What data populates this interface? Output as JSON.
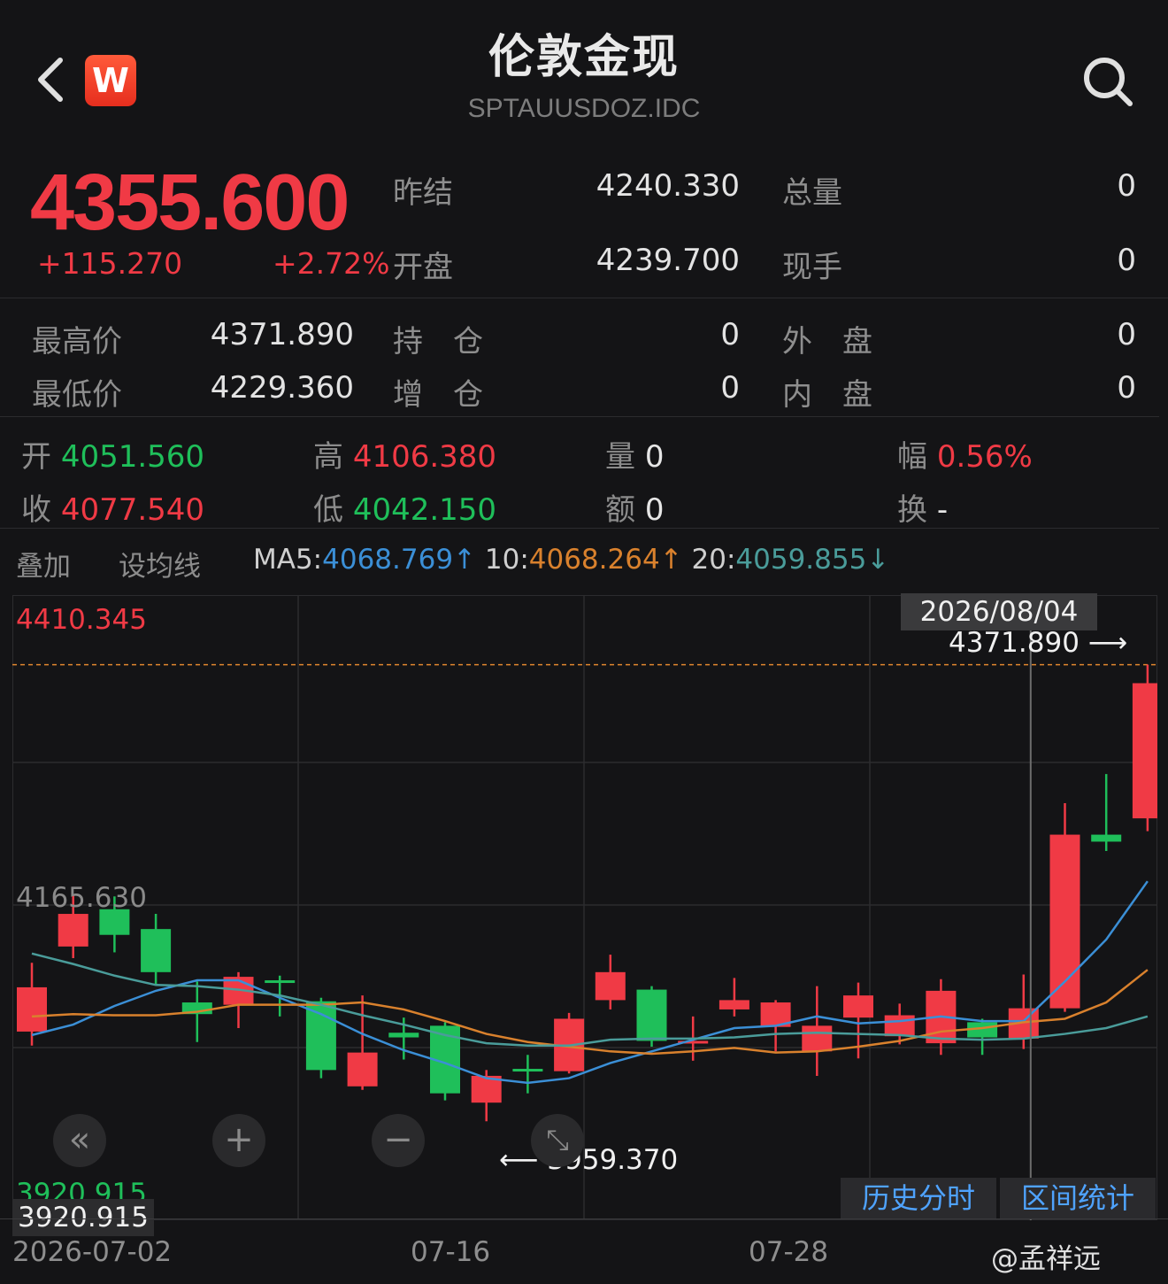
{
  "header": {
    "title": "伦敦金现",
    "code": "SPTAUUSDOZ.IDC",
    "logo_text": "W"
  },
  "quote": {
    "price": "4355.600",
    "change": "+115.270",
    "change_pct": "+2.72%",
    "prev_settle_label": "昨结",
    "prev_settle": "4240.330",
    "open_label": "开盘",
    "open": "4239.700",
    "volume_label": "总量",
    "volume": "0",
    "current_hand_label": "现手",
    "current_hand": "0",
    "high_label": "最高价",
    "high": "4371.890",
    "low_label": "最低价",
    "low": "4229.360",
    "oi_label": "持　仓",
    "oi": "0",
    "oi_chg_label": "增　仓",
    "oi_chg": "0",
    "outer_label": "外　盘",
    "outer": "0",
    "inner_label": "内　盘",
    "inner": "0"
  },
  "candle_info": {
    "open_label": "开",
    "open": "4051.560",
    "high_label": "高",
    "high": "4106.380",
    "vol_label": "量",
    "vol": "0",
    "amp_label": "幅",
    "amp": "0.56%",
    "close_label": "收",
    "close": "4077.540",
    "low_label": "低",
    "low": "4042.150",
    "amt_label": "额",
    "amt": "0",
    "turnover_label": "换",
    "turnover": "-"
  },
  "toolbar": {
    "overlay": "叠加",
    "set_ma": "设均线",
    "ma5_label": "MA5:",
    "ma5": "4068.769↑",
    "ma10_label": "10:",
    "ma10": "4068.264↑",
    "ma20_label": "20:",
    "ma20": "4059.855↓"
  },
  "chart_labels": {
    "top_price": "4410.345",
    "mid_price": "4165.630",
    "bottom_price": "3920.915",
    "bottom_price_box": "3920.915",
    "crosshair_date": "2026/08/04",
    "high_marker": "4371.890 ⟶",
    "low_marker": "⟵ 3959.370",
    "x_start": "2026-07-02",
    "x_mid1": "07-16",
    "x_mid2": "07-28",
    "btn_history": "历史分时",
    "btn_range": "区间统计",
    "watermark": "@孟祥远"
  },
  "colors": {
    "up": "#f03a45",
    "down": "#1fbf5a",
    "ma5": "#3b8fd6",
    "ma10": "#d9812d",
    "ma20": "#4a9c9a"
  },
  "chart_data": {
    "type": "candlestick",
    "ylim": [
      3920.915,
      4410.345
    ],
    "candles": [
      {
        "o": 4057,
        "c": 4095,
        "h": 4116,
        "l": 4045
      },
      {
        "o": 4130,
        "c": 4158,
        "h": 4175,
        "l": 4120
      },
      {
        "o": 4162,
        "c": 4140,
        "h": 4173,
        "l": 4125
      },
      {
        "o": 4145,
        "c": 4108,
        "h": 4158,
        "l": 4097
      },
      {
        "o": 4082,
        "c": 4072,
        "h": 4100,
        "l": 4048
      },
      {
        "o": 4080,
        "c": 4104,
        "h": 4108,
        "l": 4060
      },
      {
        "o": 4101,
        "c": 4099,
        "h": 4105,
        "l": 4070
      },
      {
        "o": 4083,
        "c": 4024,
        "h": 4086,
        "l": 4017
      },
      {
        "o": 4010,
        "c": 4039,
        "h": 4088,
        "l": 4007
      },
      {
        "o": 4056,
        "c": 4052,
        "h": 4069,
        "l": 4033
      },
      {
        "o": 4062,
        "c": 4004,
        "h": 4065,
        "l": 3998
      },
      {
        "o": 3996,
        "c": 4019,
        "h": 4024,
        "l": 3980
      },
      {
        "o": 4025,
        "c": 4023,
        "h": 4037,
        "l": 4004
      },
      {
        "o": 4023,
        "c": 4068,
        "h": 4073,
        "l": 4021
      },
      {
        "o": 4084,
        "c": 4108,
        "h": 4123,
        "l": 4076
      },
      {
        "o": 4093,
        "c": 4049,
        "h": 4096,
        "l": 4044
      },
      {
        "o": 4049,
        "c": 4049,
        "h": 4070,
        "l": 4032
      },
      {
        "o": 4076,
        "c": 4084,
        "h": 4103,
        "l": 4070
      },
      {
        "o": 4061,
        "c": 4082,
        "h": 4084,
        "l": 4040
      },
      {
        "o": 4040,
        "c": 4062,
        "h": 4096,
        "l": 4019
      },
      {
        "o": 4069,
        "c": 4088,
        "h": 4099,
        "l": 4034
      },
      {
        "o": 4053,
        "c": 4071,
        "h": 4081,
        "l": 4046
      },
      {
        "o": 4047,
        "c": 4092,
        "h": 4102,
        "l": 4037
      },
      {
        "o": 4065,
        "c": 4052,
        "h": 4068,
        "l": 4037
      },
      {
        "o": 4051,
        "c": 4077,
        "h": 4106,
        "l": 4042
      },
      {
        "o": 4077,
        "c": 4226,
        "h": 4253,
        "l": 4074
      },
      {
        "o": 4226,
        "c": 4220,
        "h": 4278,
        "l": 4212
      },
      {
        "o": 4240,
        "c": 4356,
        "h": 4372,
        "l": 4229
      }
    ],
    "ma5": [
      4054,
      4063,
      4079,
      4092,
      4101,
      4101,
      4086,
      4072,
      4055,
      4041,
      4030,
      4017,
      4013,
      4017,
      4030,
      4040,
      4050,
      4060,
      4062,
      4070,
      4064,
      4066,
      4070,
      4066,
      4066,
      4100,
      4136,
      4186
    ],
    "ma10": [
      4070,
      4072,
      4071,
      4071,
      4074,
      4080,
      4080,
      4080,
      4082,
      4076,
      4066,
      4055,
      4048,
      4044,
      4040,
      4038,
      4040,
      4043,
      4039,
      4040,
      4044,
      4049,
      4057,
      4060,
      4065,
      4068,
      4082,
      4110
    ],
    "ma20": [
      4124,
      4115,
      4105,
      4097,
      4096,
      4093,
      4088,
      4080,
      4071,
      4063,
      4054,
      4047,
      4045,
      4045,
      4050,
      4051,
      4051,
      4052,
      4055,
      4056,
      4055,
      4054,
      4051,
      4050,
      4051,
      4055,
      4060,
      4070
    ]
  }
}
